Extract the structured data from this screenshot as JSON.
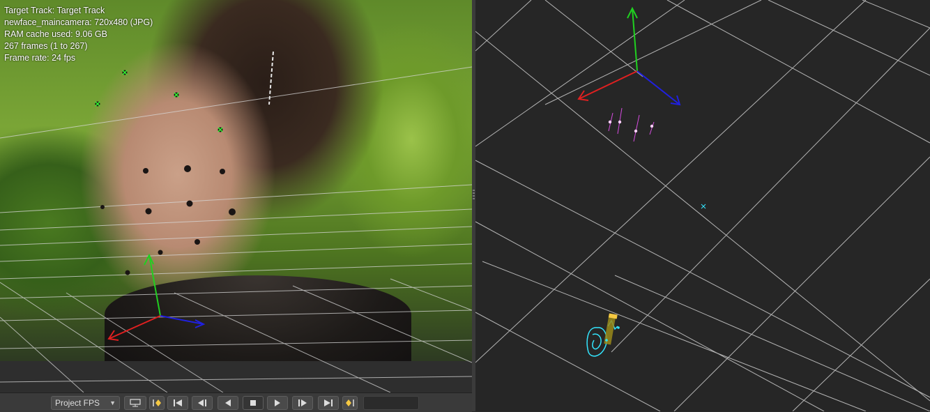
{
  "info_overlay": {
    "line1": "Target Track: Target Track",
    "line2": "newface_maincamera: 720x480 (JPG)",
    "line3": "RAM cache used: 9.06 GB",
    "line4": "267 frames (1 to 267)",
    "line5": "Frame rate: 24 fps"
  },
  "transport": {
    "fps_select_value": "Project FPS",
    "buttons": [
      "view-toggle-icon",
      "set-in-point-icon",
      "go-to-start-icon",
      "step-back-icon",
      "play-backward-icon",
      "stop-icon",
      "play-forward-icon",
      "step-forward-icon",
      "go-to-end-icon",
      "set-out-point-icon"
    ],
    "frame_field_value": ""
  },
  "colors": {
    "axis_x": "#e02020",
    "axis_y": "#20d020",
    "axis_z": "#2020e0",
    "grid": "#d8d8d8",
    "track_points": "#ff66ff",
    "camera_path": "#33e6ff",
    "key_marker": "#f5c842"
  }
}
